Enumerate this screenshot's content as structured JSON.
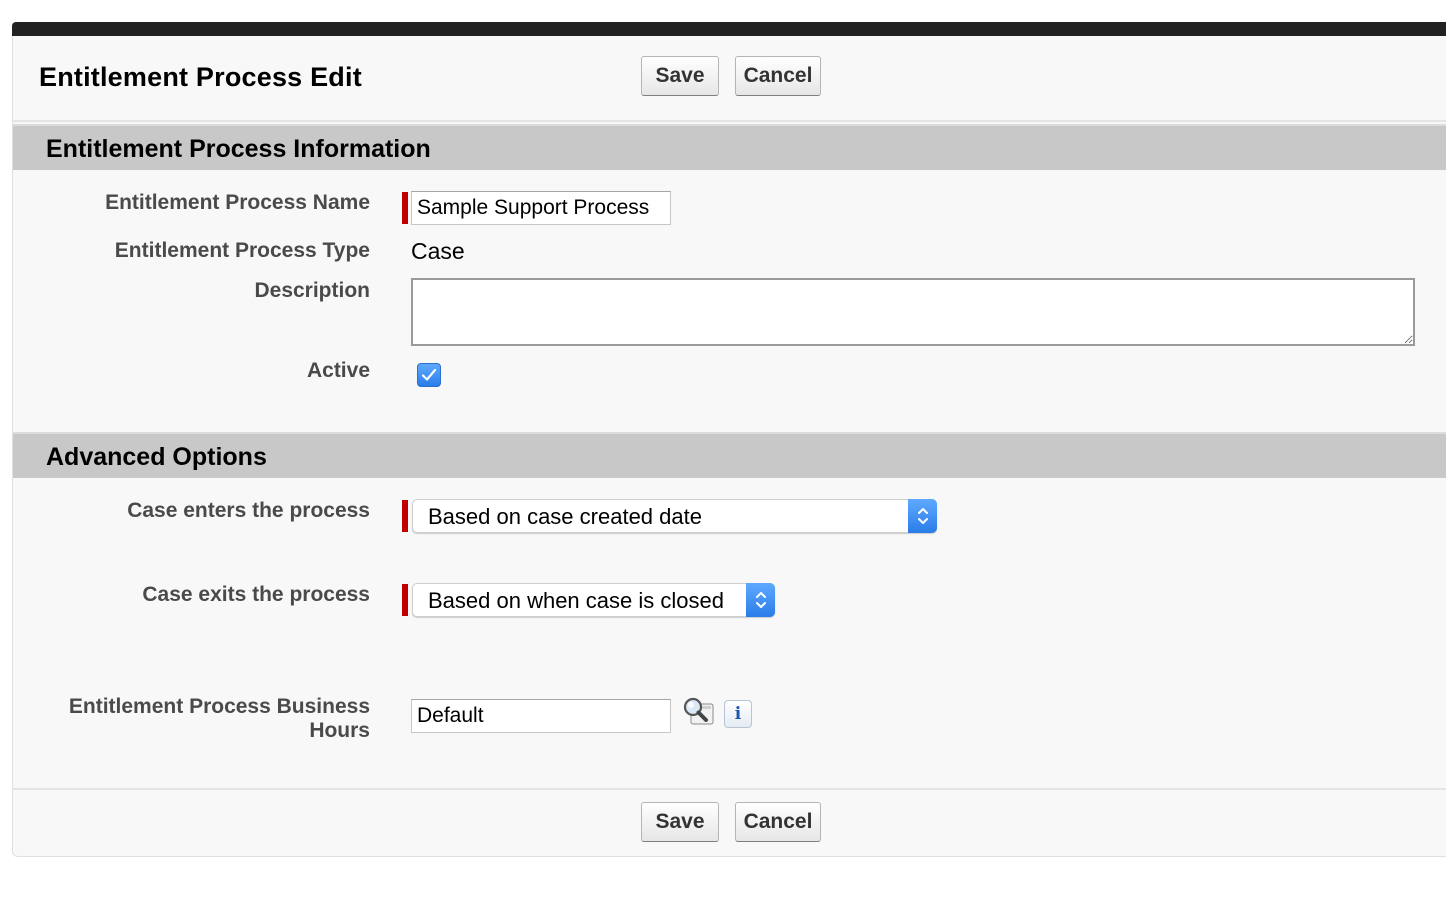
{
  "page": {
    "title": "Entitlement Process Edit"
  },
  "buttons": {
    "save_label": "Save",
    "cancel_label": "Cancel"
  },
  "sections": {
    "information": {
      "title": "Entitlement Process Information",
      "fields": {
        "name": {
          "label": "Entitlement Process Name",
          "value": "Sample Support Process",
          "required": true
        },
        "type": {
          "label": "Entitlement Process Type",
          "value": "Case"
        },
        "description": {
          "label": "Description",
          "value": ""
        },
        "active": {
          "label": "Active",
          "checked": true
        }
      }
    },
    "advanced": {
      "title": "Advanced Options",
      "fields": {
        "case_enters": {
          "label": "Case enters the process",
          "selected": "Based on case created date",
          "required": true
        },
        "case_exits": {
          "label": "Case exits the process",
          "selected": "Based on when case is closed",
          "required": true
        },
        "business_hours": {
          "label_line1": "Entitlement Process Business",
          "label_line2": "Hours",
          "value": "Default"
        }
      }
    }
  },
  "icons": {
    "lookup": "magnifier-lookup-icon",
    "info": "info-icon",
    "checkmark": "checkmark-icon",
    "select_arrows": "updown-chevron-icon"
  },
  "colors": {
    "required_marker": "#c00000",
    "accent_blue": "#2a7de8",
    "section_header_bg": "#c8c8c8"
  }
}
